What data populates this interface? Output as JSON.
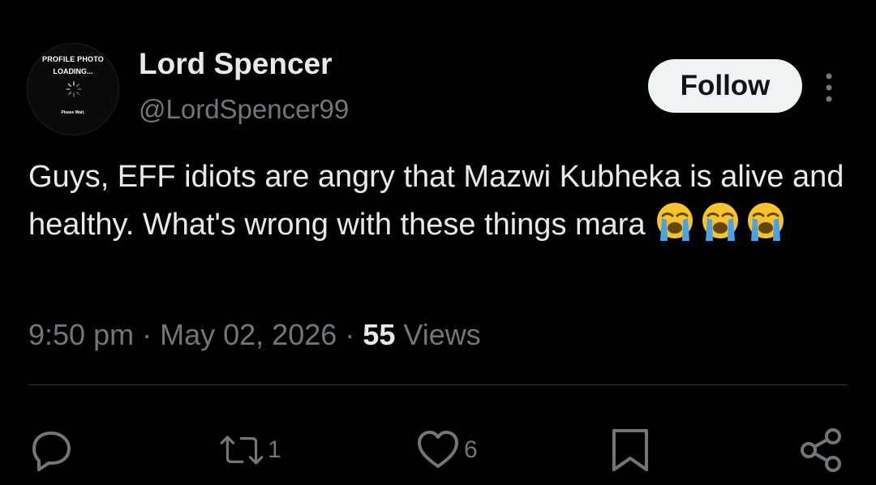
{
  "profile": {
    "photo_line1": "PROFILE PHOTO",
    "photo_line2": "LOADING...",
    "photo_line3": "Please Wait.",
    "name": "Lord Spencer",
    "handle": "@LordSpencer99"
  },
  "follow_label": "Follow",
  "tweet": {
    "text": "Guys, EFF idiots are angry that Mazwi Kubheka is alive and healthy. What's wrong with these things mara",
    "emoji": "loudly-crying-face"
  },
  "meta": {
    "time": "9:50 pm",
    "separator": "·",
    "date": "May 02, 2026",
    "views_count": "55",
    "views_label": "Views"
  },
  "actions": {
    "retweet_count": "1",
    "like_count": "6"
  },
  "colors": {
    "background": "#000000",
    "text": "#e7e9ea",
    "muted": "#71767b",
    "follow_bg": "#eff3f4",
    "divider": "#2f3336"
  }
}
